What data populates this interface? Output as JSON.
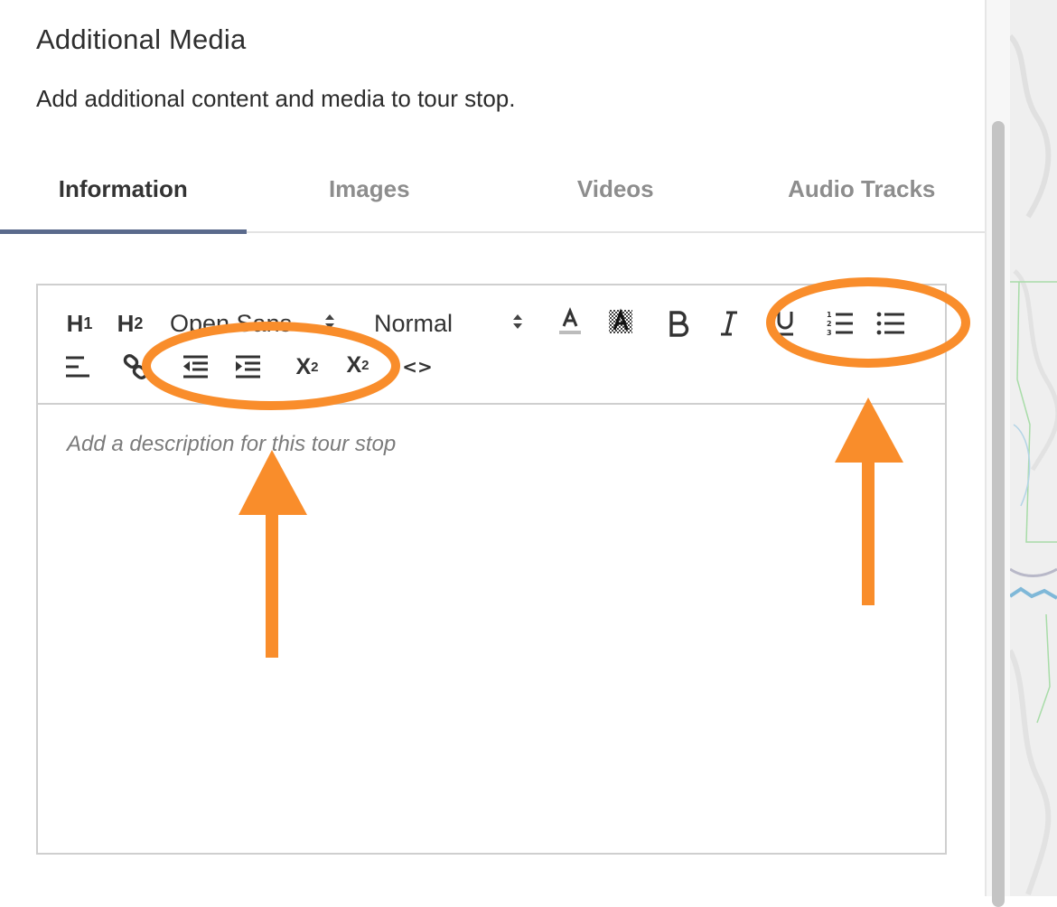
{
  "panel": {
    "title": "Additional Media",
    "subtitle": "Add additional content and media to tour stop."
  },
  "tabs": [
    {
      "label": "Information",
      "active": true
    },
    {
      "label": "Images",
      "active": false
    },
    {
      "label": "Videos",
      "active": false
    },
    {
      "label": "Audio Tracks",
      "active": false
    }
  ],
  "toolbar": {
    "h1_label": "H",
    "h1_sub": "1",
    "h2_label": "H",
    "h2_sub": "2",
    "font_picker": "Open Sans",
    "size_picker": "Normal",
    "subscript_label": "X",
    "subscript_sub": "2",
    "superscript_label": "X",
    "superscript_sup": "2",
    "code_label": "<>",
    "icons": [
      "text-color-icon",
      "background-color-icon",
      "bold-icon",
      "italic-icon",
      "underline-icon",
      "ordered-list-icon",
      "bullet-list-icon",
      "align-icon",
      "link-icon",
      "indent-decrease-icon",
      "indent-increase-icon",
      "subscript-icon",
      "superscript-icon",
      "code-icon"
    ]
  },
  "editor": {
    "placeholder": "Add a description for this tour stop"
  },
  "colors": {
    "accent_tab": "#5a6a8c",
    "annotation": "#f98d2b"
  }
}
